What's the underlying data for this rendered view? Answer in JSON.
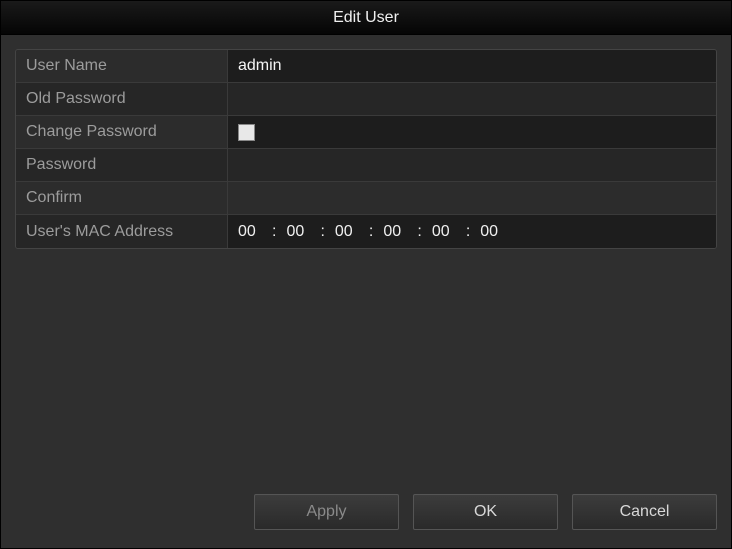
{
  "title": "Edit User",
  "form": {
    "user_name": {
      "label": "User Name",
      "value": "admin"
    },
    "old_password": {
      "label": "Old Password",
      "value": ""
    },
    "change_password": {
      "label": "Change Password",
      "checked": false
    },
    "password": {
      "label": "Password",
      "value": ""
    },
    "confirm": {
      "label": "Confirm",
      "value": ""
    },
    "mac": {
      "label": "User's MAC Address",
      "segments": [
        "00",
        "00",
        "00",
        "00",
        "00",
        "00"
      ]
    }
  },
  "buttons": {
    "apply": "Apply",
    "ok": "OK",
    "cancel": "Cancel"
  }
}
